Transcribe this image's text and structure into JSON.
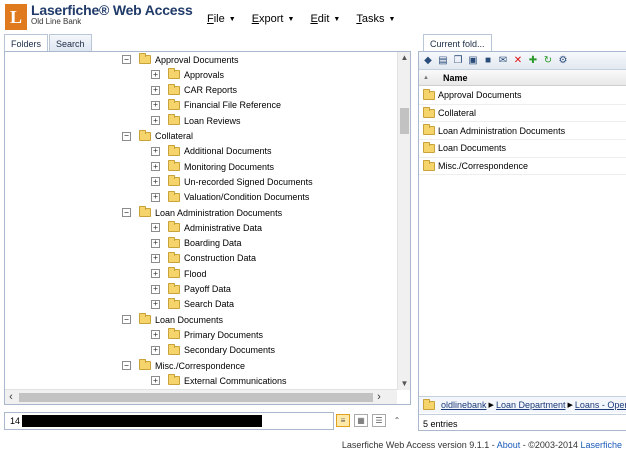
{
  "header": {
    "logo_letter": "L",
    "brand_title": "Laserfiche® Web Access",
    "brand_subtitle": "Old Line Bank",
    "menu": [
      {
        "label": "File",
        "u": "F",
        "rest": "ile"
      },
      {
        "label": "Export",
        "u": "E",
        "rest": "xport"
      },
      {
        "label": "Edit",
        "u": "E",
        "rest": "dit"
      },
      {
        "label": "Tasks",
        "u": "T",
        "rest": "asks"
      }
    ]
  },
  "tabs": {
    "folders": "Folders",
    "search": "Search",
    "current": "Current fold..."
  },
  "tree": [
    {
      "label": "Approval Documents",
      "level": 0,
      "expander": "−"
    },
    {
      "label": "Approvals",
      "level": 1,
      "expander": "+"
    },
    {
      "label": "CAR Reports",
      "level": 1,
      "expander": "+"
    },
    {
      "label": "Financial File Reference",
      "level": 1,
      "expander": "+"
    },
    {
      "label": "Loan Reviews",
      "level": 1,
      "expander": "+"
    },
    {
      "label": "Collateral",
      "level": 0,
      "expander": "−"
    },
    {
      "label": "Additional Documents",
      "level": 1,
      "expander": "+"
    },
    {
      "label": "Monitoring Documents",
      "level": 1,
      "expander": "+"
    },
    {
      "label": "Un-recorded Signed Documents",
      "level": 1,
      "expander": "+"
    },
    {
      "label": "Valuation/Condition Documents",
      "level": 1,
      "expander": "+"
    },
    {
      "label": "Loan Administration Documents",
      "level": 0,
      "expander": "−"
    },
    {
      "label": "Administrative Data",
      "level": 1,
      "expander": "+"
    },
    {
      "label": "Boarding Data",
      "level": 1,
      "expander": "+"
    },
    {
      "label": "Construction Data",
      "level": 1,
      "expander": "+"
    },
    {
      "label": "Flood",
      "level": 1,
      "expander": "+"
    },
    {
      "label": "Payoff Data",
      "level": 1,
      "expander": "+"
    },
    {
      "label": "Search Data",
      "level": 1,
      "expander": "+"
    },
    {
      "label": "Loan Documents",
      "level": 0,
      "expander": "−"
    },
    {
      "label": "Primary Documents",
      "level": 1,
      "expander": "+"
    },
    {
      "label": "Secondary Documents",
      "level": 1,
      "expander": "+"
    },
    {
      "label": "Misc./Correspondence",
      "level": 0,
      "expander": "−"
    },
    {
      "label": "External Communications",
      "level": 1,
      "expander": "+"
    }
  ],
  "path_box": {
    "prefix": "14"
  },
  "right": {
    "column_header": "Name",
    "folders": [
      "Approval Documents",
      "Collateral",
      "Loan Administration Documents",
      "Loan Documents",
      "Misc./Correspondence"
    ],
    "breadcrumb": [
      "oldlinebank",
      "Loan Department",
      "Loans - Open"
    ],
    "entries": "5 entries"
  },
  "footer": {
    "prefix": "Laserfiche Web Access version 9.1.1 - ",
    "about": "About",
    "middle": " - ©2003-2014 ",
    "brand": "Laserfiche"
  },
  "colors": {
    "brand_orange": "#e07a1f",
    "brand_navy": "#203a6a",
    "folder_yellow": "#f5d56b",
    "link_blue": "#1a5bb8"
  }
}
